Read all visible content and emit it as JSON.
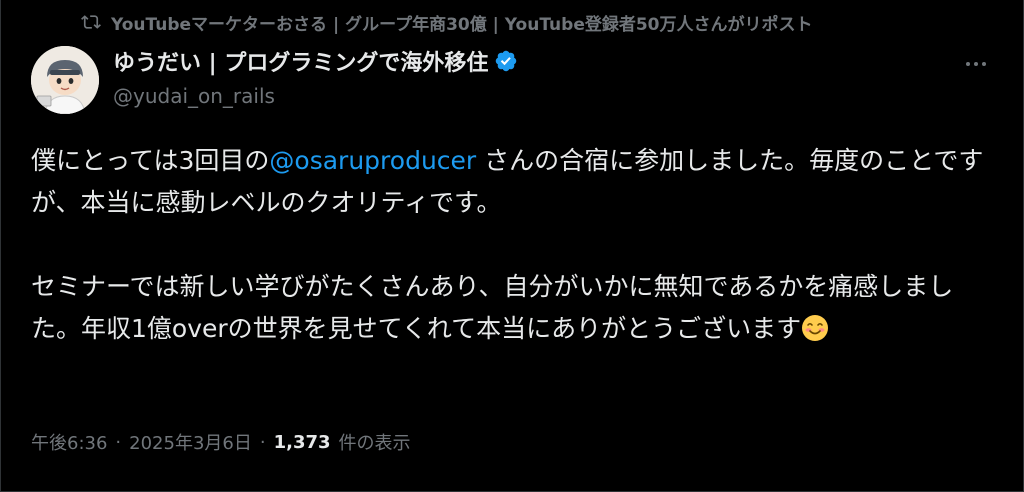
{
  "repost": {
    "text": "YouTubeマーケターおさる | グループ年商30億 | YouTube登録者50万人さんがリポスト"
  },
  "author": {
    "display_name": "ゆうだい | プログラミングで海外移住",
    "handle": "@yudai_on_rails",
    "verified_color": "#1d9bf0"
  },
  "tweet": {
    "p1_before": "僕にとっては3回目の",
    "p1_mention": "@osaruproducer",
    "p1_after": " さんの合宿に参加しました。毎度のことですが、本当に感動レベルのクオリティです。",
    "p2": "セミナーでは新しい学びがたくさんあり、自分がいかに無知であるかを痛感しました。年収1億overの世界を見せてくれて本当にありがとうございます",
    "emoji": "smiling-face-with-smiling-eyes"
  },
  "meta": {
    "time": "午後6:36",
    "separator": "·",
    "date": "2025年3月6日",
    "views_count": "1,373",
    "views_label": "件の表示"
  },
  "colors": {
    "background": "#000000",
    "text": "#e7e9ea",
    "secondary": "#71767b",
    "accent": "#1d9bf0"
  }
}
